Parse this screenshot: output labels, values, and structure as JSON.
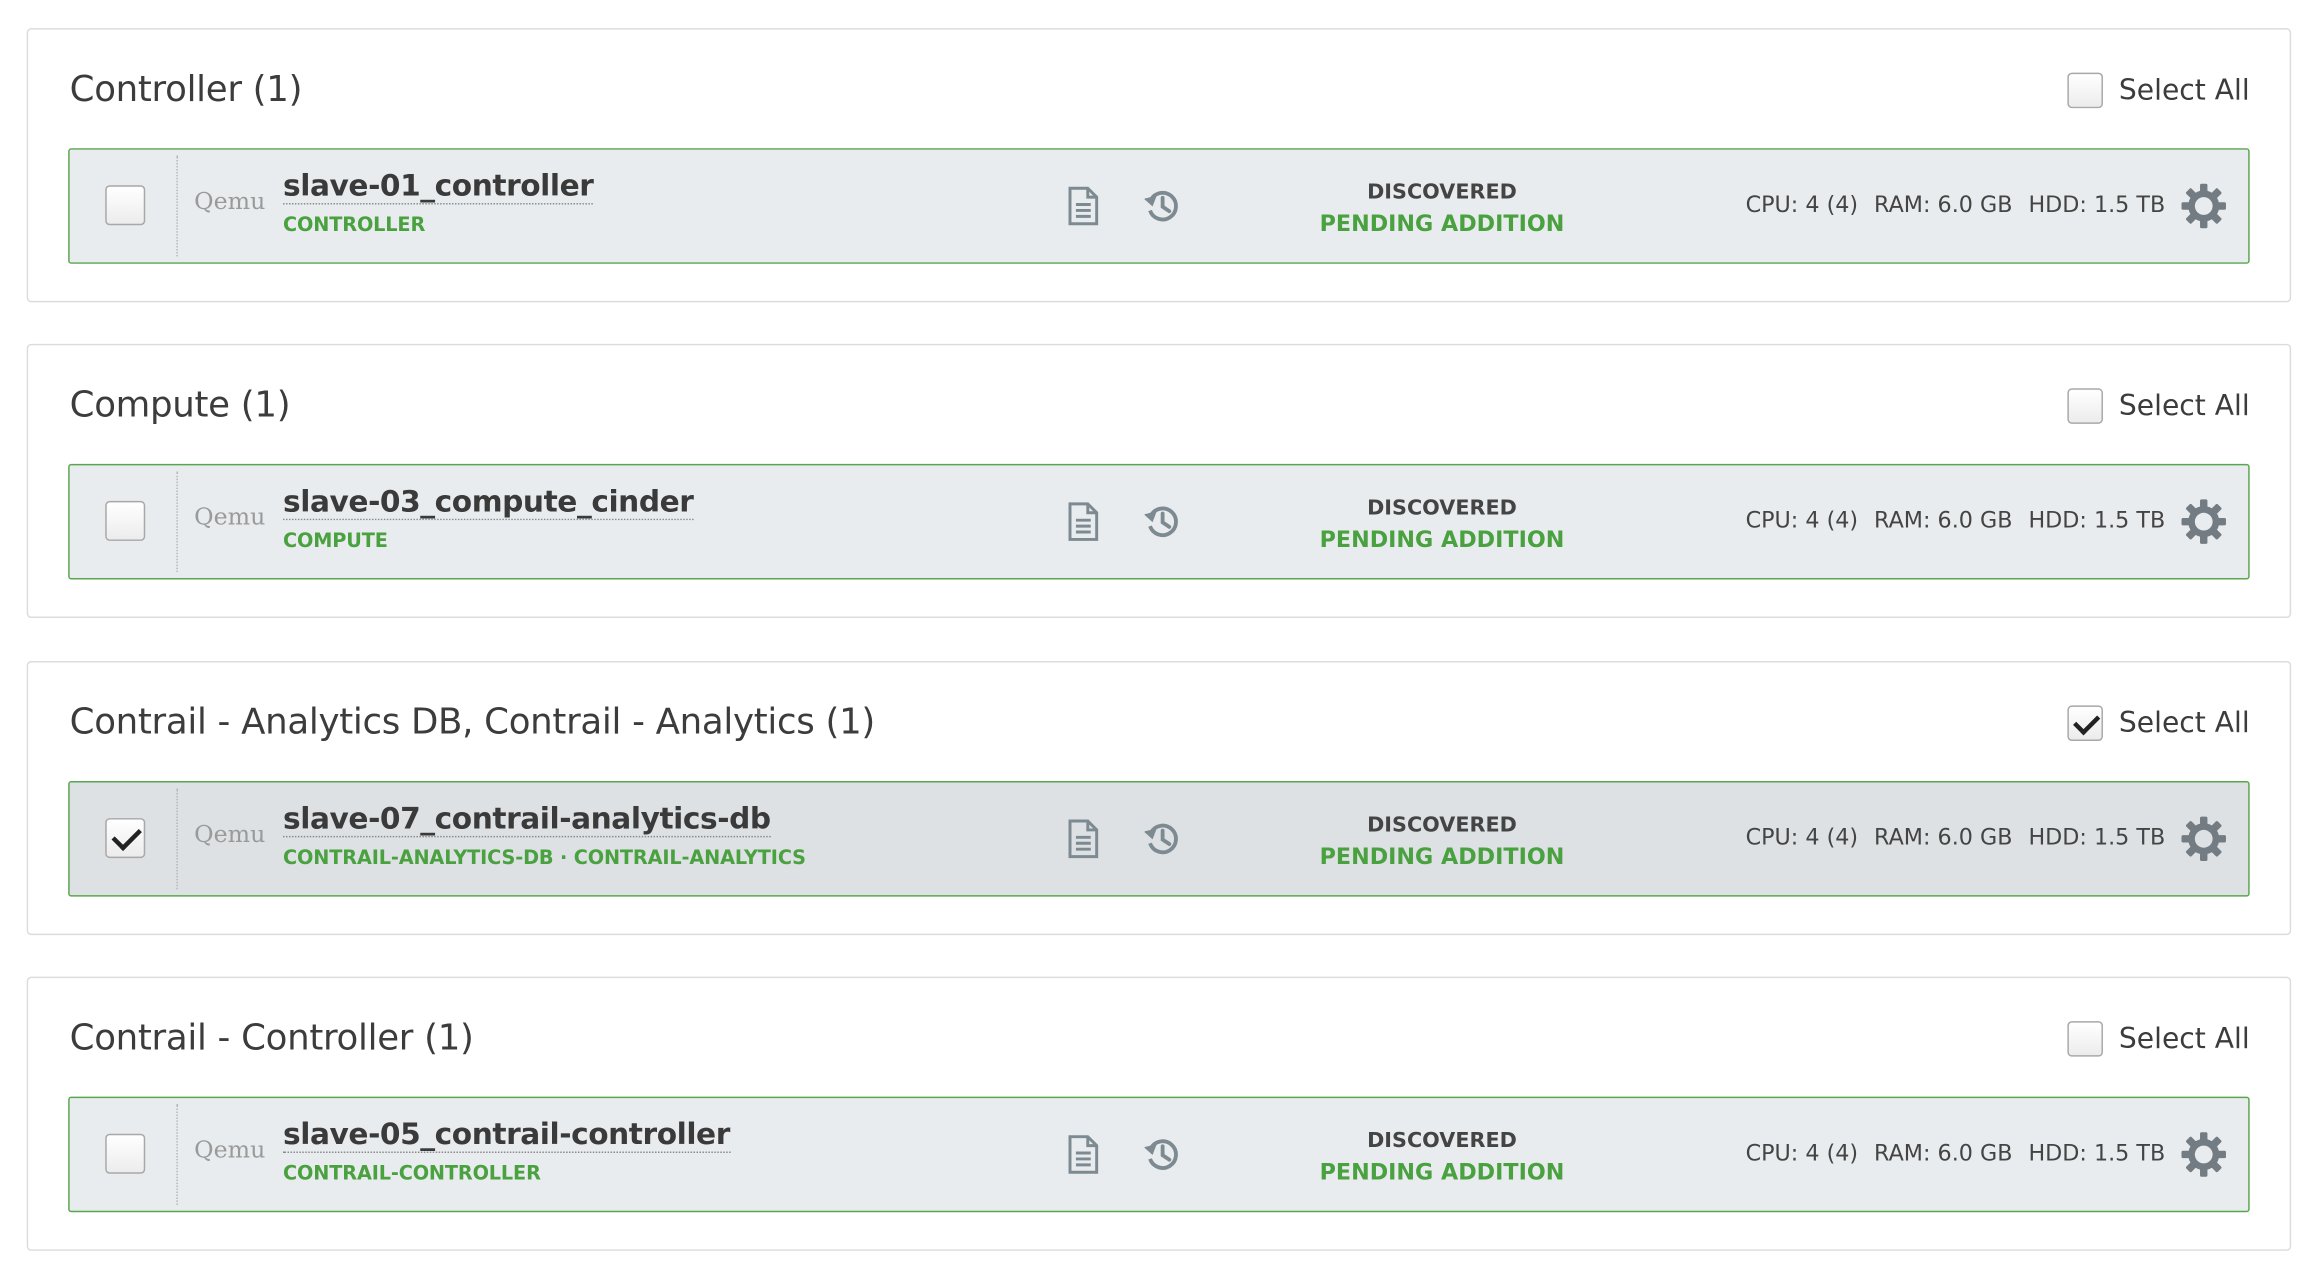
{
  "select_all_label": "Select All",
  "groups": [
    {
      "title": "Controller (1)",
      "select_all_checked": false,
      "node": {
        "checked": false,
        "vendor": "Qemu",
        "name": "slave-01_controller",
        "roles": "CONTROLLER",
        "status": "DISCOVERED",
        "pending": "PENDING ADDITION",
        "cpu": "CPU: 4 (4)",
        "ram": "RAM: 6.0 GB",
        "hdd": "HDD: 1.5 TB"
      }
    },
    {
      "title": "Compute (1)",
      "select_all_checked": false,
      "node": {
        "checked": false,
        "vendor": "Qemu",
        "name": "slave-03_compute_cinder",
        "roles": "COMPUTE",
        "status": "DISCOVERED",
        "pending": "PENDING ADDITION",
        "cpu": "CPU: 4 (4)",
        "ram": "RAM: 6.0 GB",
        "hdd": "HDD: 1.5 TB"
      }
    },
    {
      "title": "Contrail - Analytics DB, Contrail - Analytics (1)",
      "select_all_checked": true,
      "node": {
        "checked": true,
        "vendor": "Qemu",
        "name": "slave-07_contrail-analytics-db",
        "roles": "CONTRAIL-ANALYTICS-DB · CONTRAIL-ANALYTICS",
        "status": "DISCOVERED",
        "pending": "PENDING ADDITION",
        "cpu": "CPU: 4 (4)",
        "ram": "RAM: 6.0 GB",
        "hdd": "HDD: 1.5 TB"
      }
    },
    {
      "title": "Contrail - Controller (1)",
      "select_all_checked": false,
      "node": {
        "checked": false,
        "vendor": "Qemu",
        "name": "slave-05_contrail-controller",
        "roles": "CONTRAIL-CONTROLLER",
        "status": "DISCOVERED",
        "pending": "PENDING ADDITION",
        "cpu": "CPU: 4 (4)",
        "ram": "RAM: 6.0 GB",
        "hdd": "HDD: 1.5 TB"
      }
    }
  ],
  "icons": {
    "logs": "file-text-icon",
    "history": "history-icon",
    "settings": "gear-icon"
  },
  "colors": {
    "accent_green": "#4aa13f",
    "node_border": "#5aa64e",
    "node_background": "#e9ecee"
  }
}
